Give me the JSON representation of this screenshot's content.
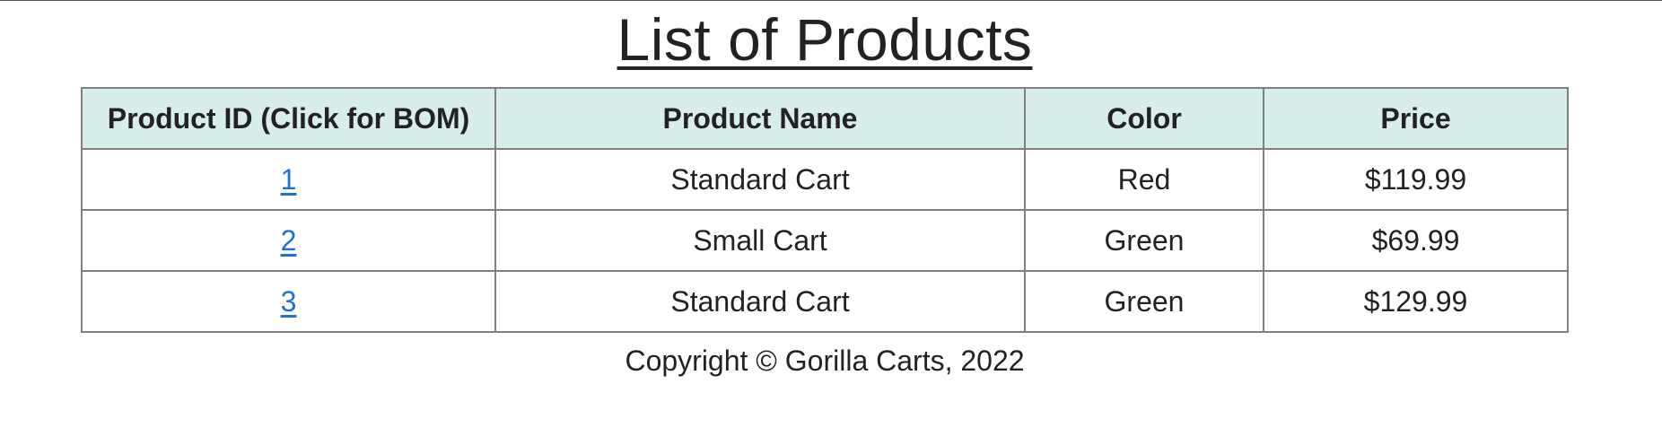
{
  "page": {
    "title": "List of Products",
    "footer": "Copyright © Gorilla Carts, 2022"
  },
  "table": {
    "headers": [
      "Product ID (Click for BOM)",
      "Product Name",
      "Color",
      "Price"
    ],
    "rows": [
      {
        "id": "1",
        "name": "Standard Cart",
        "color": "Red",
        "price": "$119.99"
      },
      {
        "id": "2",
        "name": "Small Cart",
        "color": "Green",
        "price": "$69.99"
      },
      {
        "id": "3",
        "name": "Standard Cart",
        "color": "Green",
        "price": "$129.99"
      }
    ]
  },
  "colors": {
    "header_bg": "#d8eeec",
    "link": "#1f6fd6",
    "border": "#808080"
  }
}
